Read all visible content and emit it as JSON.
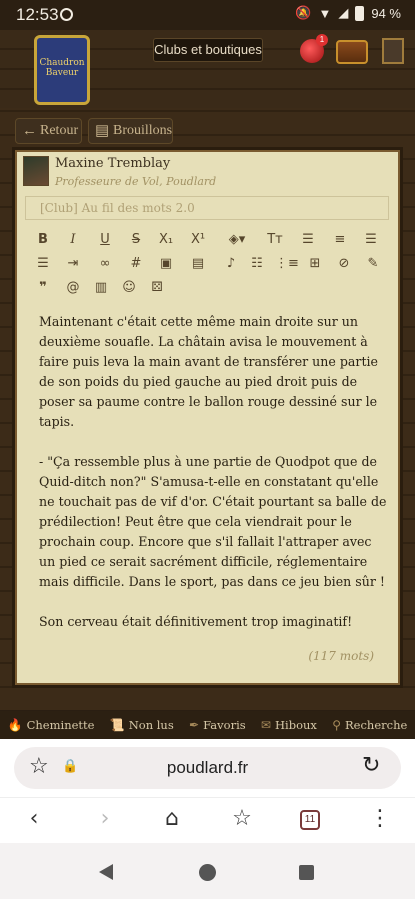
{
  "status_bar": {
    "time": "12:53",
    "battery": "94 %"
  },
  "header": {
    "clubs_button": "Clubs et boutiques",
    "notification_count": "1",
    "logo_text": "Chaudron Baveur"
  },
  "nav_buttons": {
    "back": "Retour",
    "drafts": "Brouillons"
  },
  "post": {
    "author": "Maxine Tremblay",
    "role": "Professeure de Vol, Poudlard",
    "topic": "[Club] Au fil des mots 2.0",
    "body": "Maintenant c'était cette même main droite sur un deuxième souafle. La châtain avisa le mouvement à faire puis leva la main avant de transférer une partie de son poids du pied gauche au pied droit puis de poser sa paume contre le ballon rouge dessiné sur le tapis.\n\n- \"Ça ressemble plus à une partie de Quodpot que de Quid-ditch non?\" S'amusa-t-elle en constatant qu'elle ne touchait pas de vif d'or. C'était pourtant sa balle de prédilection! Peut être que cela viendrait pour le prochain coup. Encore que s'il fallait l'attraper avec un pied ce serait sacrément difficile, réglementaire mais difficile. Dans le sport, pas dans ce jeu bien sûr !\n\nSon cerveau était définitivement trop imaginatif!",
    "word_count": "(117 mots)"
  },
  "toolbar": {
    "buttons": [
      "bold-icon",
      "italic-icon",
      "underline-icon",
      "strikethrough-icon",
      "subscript-icon",
      "superscript-icon",
      "color-fill-icon",
      "text-size-icon",
      "align-left-icon",
      "align-center-icon",
      "align-right-icon",
      "justify-icon",
      "indent-icon",
      "link-icon",
      "hashtag-icon",
      "image-icon",
      "video-icon",
      "music-icon",
      "bullet-list-icon",
      "numbered-list-icon",
      "table-icon",
      "hide-icon",
      "pencil-icon",
      "quote-icon",
      "mention-icon",
      "spoiler-icon",
      "emoji-icon",
      "dice-icon"
    ]
  },
  "footer": {
    "items": [
      "Cheminette",
      "Non lus",
      "Favoris",
      "Hiboux",
      "Recherche"
    ]
  },
  "browser": {
    "url": "poudlard.fr",
    "tab_count": "11"
  }
}
